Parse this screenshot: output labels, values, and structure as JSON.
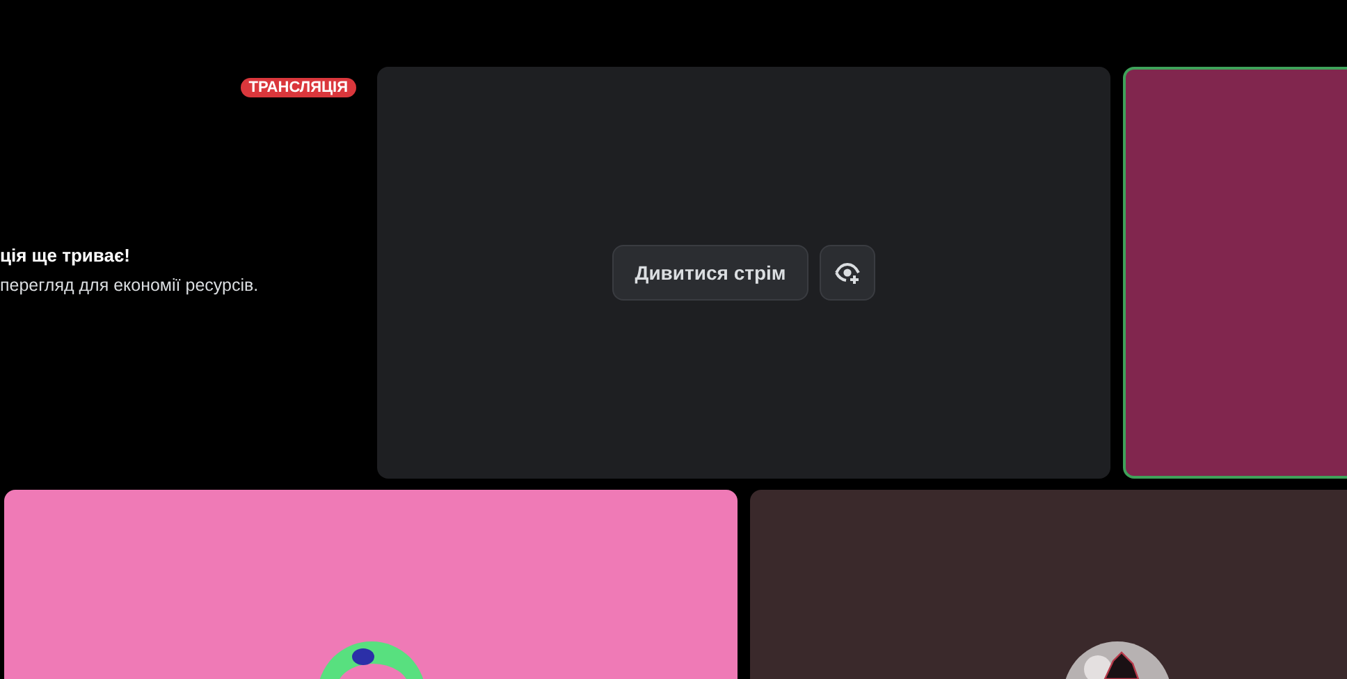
{
  "stream_notice": {
    "badge": "ТРАНСЛЯЦІЯ",
    "title": "ція ще триває!",
    "subtitle": "перегляд для економії ресурсів."
  },
  "top_tiles": [
    {
      "kind": "stream",
      "speaking": false,
      "watch_button": "Дивитися стрім"
    },
    {
      "kind": "user",
      "speaking": true,
      "color": "#81264e"
    }
  ],
  "bottom_tiles": [
    {
      "kind": "user",
      "speaking": false,
      "color": "#ef7ab6"
    },
    {
      "kind": "user",
      "speaking": false,
      "color": "#3a292b"
    }
  ]
}
